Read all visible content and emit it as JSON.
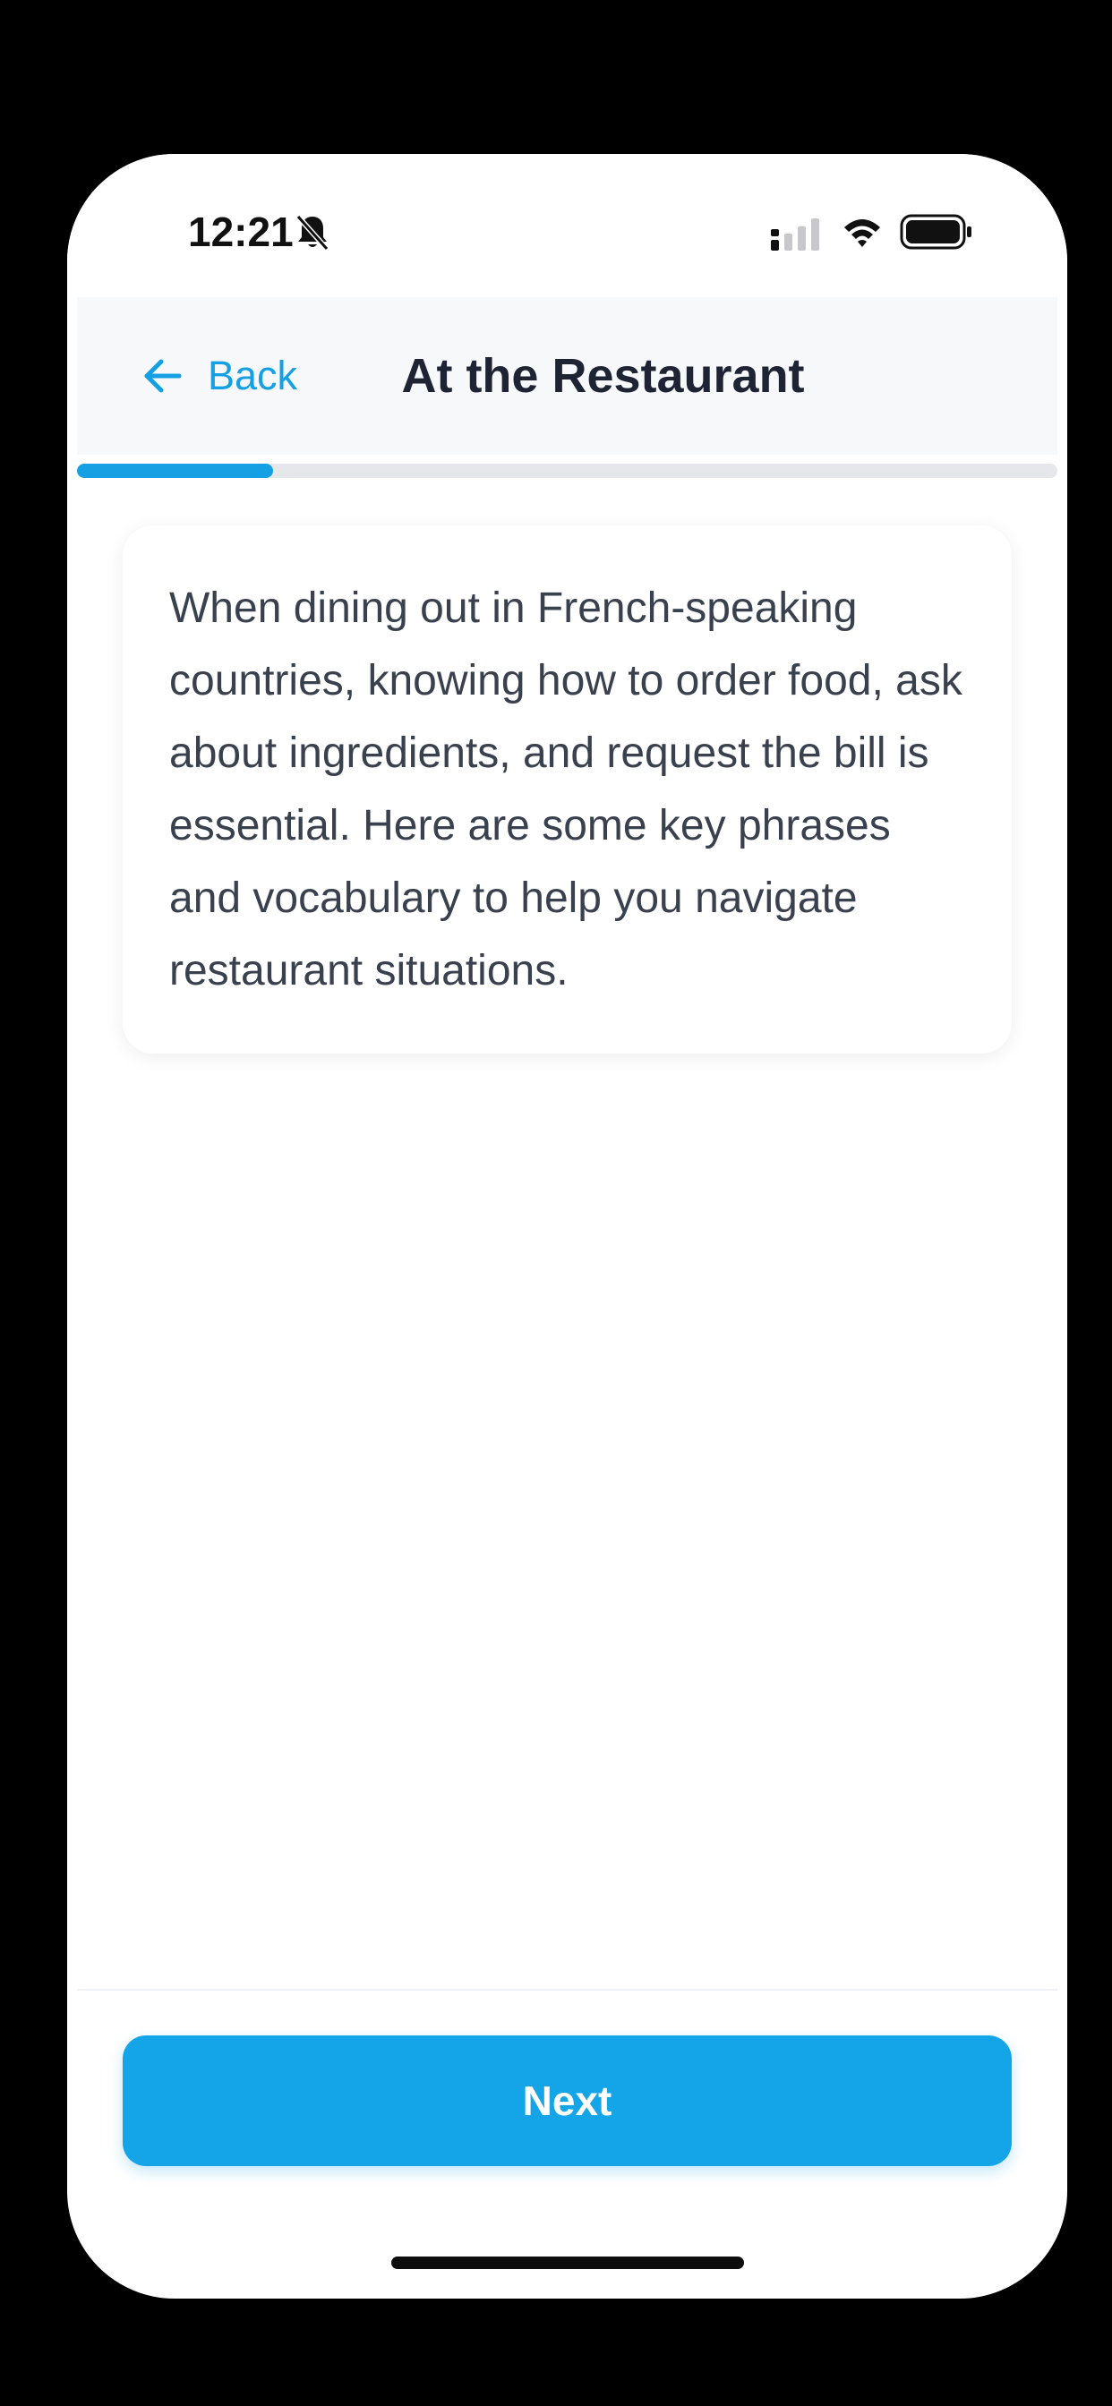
{
  "status_bar": {
    "time": "12:21",
    "icons": [
      "bell-slash-icon",
      "signal-icon",
      "wifi-icon",
      "battery-icon"
    ]
  },
  "header": {
    "back_label": "Back",
    "title": "At the Restaurant"
  },
  "progress": {
    "fraction": 0.2
  },
  "content": {
    "text": "When dining out in French-speaking countries, knowing how to order food, ask about ingredients, and request the bill is essential. Here are some key phrases and vocabulary to help you navigate restaurant situations."
  },
  "footer": {
    "next_label": "Next"
  },
  "colors": {
    "accent": "#14a0e3",
    "title": "#1e2434",
    "body_text": "#39404e",
    "header_bg": "#f7f8fa",
    "progress_track": "#e6e7eb"
  }
}
